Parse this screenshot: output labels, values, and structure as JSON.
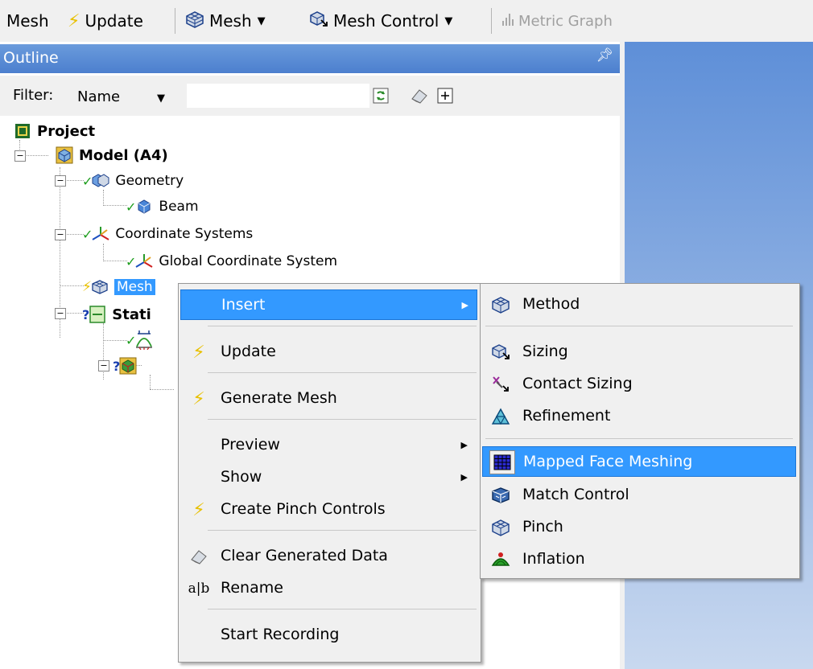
{
  "toolbar": {
    "mesh_label": "Mesh",
    "update_label": "Update",
    "mesh_dropdown_label": "Mesh",
    "mesh_control_label": "Mesh Control",
    "metric_graph_label": "Metric Graph"
  },
  "outline": {
    "title": "Outline",
    "filter_label": "Filter:",
    "filter_value": "Name",
    "filter_text": ""
  },
  "tree": {
    "project": "Project",
    "model": "Model (A4)",
    "geometry": "Geometry",
    "beam": "Beam",
    "coordinate_systems": "Coordinate Systems",
    "global_cs": "Global Coordinate System",
    "mesh": "Mesh",
    "static": "Stati"
  },
  "context_menu": {
    "insert": "Insert",
    "update": "Update",
    "generate_mesh": "Generate Mesh",
    "preview": "Preview",
    "show": "Show",
    "create_pinch_controls": "Create Pinch Controls",
    "clear_generated_data": "Clear Generated Data",
    "rename": "Rename",
    "start_recording": "Start Recording"
  },
  "insert_submenu": {
    "method": "Method",
    "sizing": "Sizing",
    "contact_sizing": "Contact Sizing",
    "refinement": "Refinement",
    "mapped_face_meshing": "Mapped Face Meshing",
    "match_control": "Match Control",
    "pinch": "Pinch",
    "inflation": "Inflation"
  },
  "colors": {
    "selection": "#3399ff",
    "header": "#4c7fce",
    "check": "#1e9e1e",
    "bolt": "#e8c000",
    "question": "#1a3fb0"
  }
}
